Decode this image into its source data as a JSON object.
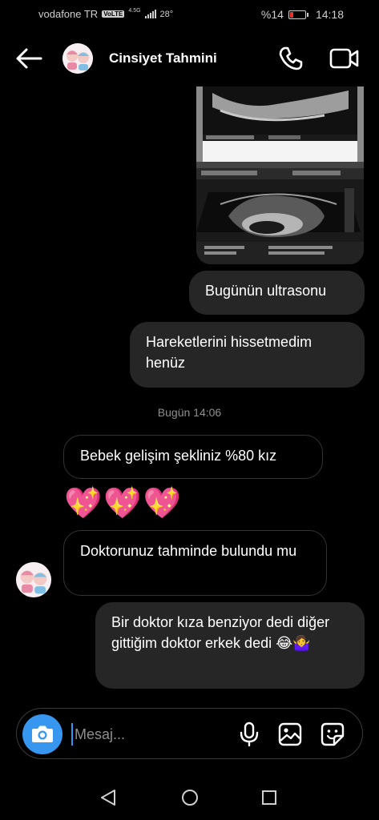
{
  "status_bar": {
    "carrier": "vodafone TR",
    "volte": "VoLTE",
    "network": "4.5G",
    "temperature": "28°",
    "battery_percent": "%14",
    "time": "14:18"
  },
  "header": {
    "contact_name": "Cinsiyet Tahmini"
  },
  "messages": [
    {
      "direction": "out",
      "text": "Bugünün ultrasonu"
    },
    {
      "direction": "out",
      "text": "Hareketlerini hissetmedim henüz"
    },
    {
      "direction": "in",
      "text": "Bebek gelişim şekliniz %80 kız"
    },
    {
      "direction": "in",
      "text": "💖💖💖"
    },
    {
      "direction": "in",
      "text": "Doktorunuz tahminde bulundu mu"
    },
    {
      "direction": "out",
      "text": "Bir doktor kıza benziyor dedi diğer gittiğim doktor erkek dedi 😂🤷‍♀️"
    }
  ],
  "timestamp": "Bugün 14:06",
  "composer": {
    "placeholder": "Mesaj..."
  },
  "icons": [
    "back-arrow-icon",
    "phone-icon",
    "video-camera-icon",
    "camera-icon",
    "microphone-icon",
    "gallery-icon",
    "sticker-icon",
    "nav-back-icon",
    "nav-home-icon",
    "nav-recents-icon"
  ],
  "colors": {
    "background": "#000000",
    "outgoing_bubble": "#262626",
    "accent": "#3797f0",
    "timestamp": "#8e8e8e"
  }
}
